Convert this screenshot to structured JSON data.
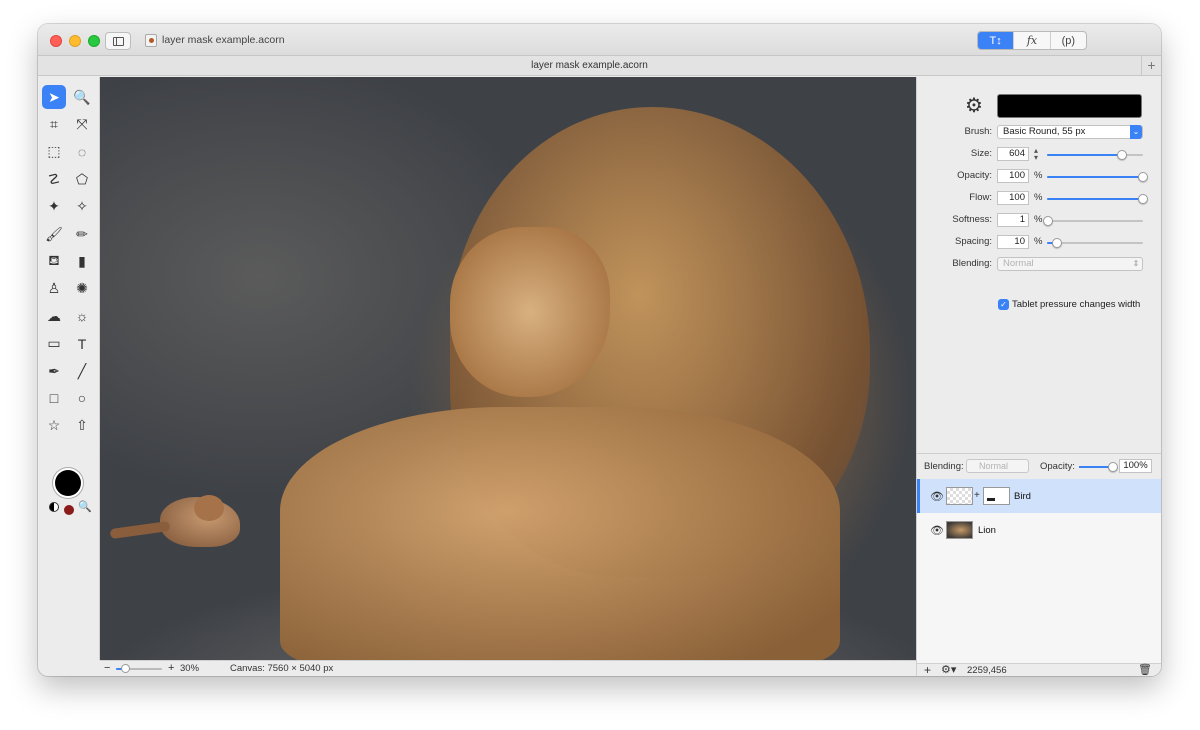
{
  "window": {
    "title": "layer mask example.acorn",
    "tab_title": "layer mask example.acorn",
    "mode_buttons": [
      "T↕",
      "fx",
      "(p)"
    ]
  },
  "tools": [
    {
      "name": "select-arrow-tool-icon",
      "glyph": "➤",
      "active": true
    },
    {
      "name": "zoom-tool-icon",
      "glyph": "🔍"
    },
    {
      "name": "crop-tool-icon",
      "glyph": "⌗"
    },
    {
      "name": "transform-tool-icon",
      "glyph": "⤧"
    },
    {
      "name": "rect-marquee-tool-icon",
      "glyph": "⬚"
    },
    {
      "name": "ellipse-marquee-tool-icon",
      "glyph": "◌"
    },
    {
      "name": "lasso-tool-icon",
      "glyph": "☡"
    },
    {
      "name": "polygon-lasso-tool-icon",
      "glyph": "⬠"
    },
    {
      "name": "magic-wand-tool-icon",
      "glyph": "✦"
    },
    {
      "name": "instant-alpha-tool-icon",
      "glyph": "✧"
    },
    {
      "name": "brush-tool-icon",
      "glyph": "🖌"
    },
    {
      "name": "pencil-tool-icon",
      "glyph": "✏"
    },
    {
      "name": "paint-bucket-tool-icon",
      "glyph": "⛾"
    },
    {
      "name": "eraser-tool-icon",
      "glyph": "▮"
    },
    {
      "name": "clone-tool-icon",
      "glyph": "♙"
    },
    {
      "name": "smudge-tool-icon",
      "glyph": "✺"
    },
    {
      "name": "shape-cloud-tool-icon",
      "glyph": "☁"
    },
    {
      "name": "light-tool-icon",
      "glyph": "☼"
    },
    {
      "name": "gradient-tool-icon",
      "glyph": "▭"
    },
    {
      "name": "text-tool-icon",
      "glyph": "T"
    },
    {
      "name": "bezier-pen-tool-icon",
      "glyph": "✒"
    },
    {
      "name": "line-tool-icon",
      "glyph": "╱"
    },
    {
      "name": "rectangle-tool-icon",
      "glyph": "□"
    },
    {
      "name": "oval-tool-icon",
      "glyph": "○"
    },
    {
      "name": "star-tool-icon",
      "glyph": "☆"
    },
    {
      "name": "arrow-tool-icon",
      "glyph": "⇧"
    }
  ],
  "colors": {
    "foreground": "#000000",
    "background": "#8b1a1a",
    "accent": "#3b82f7"
  },
  "status": {
    "zoom": "30%",
    "zoom_fraction": 0.2,
    "canvas_size": "Canvas: 7560 × 5040 px"
  },
  "brush": {
    "brush_label": "Brush:",
    "brush_value": "Basic Round, 55 px",
    "size_label": "Size:",
    "size_value": "604",
    "size_fraction": 0.78,
    "opacity_label": "Opacity:",
    "opacity_value": "100",
    "opacity_fraction": 1.0,
    "flow_label": "Flow:",
    "flow_value": "100",
    "flow_fraction": 1.0,
    "softness_label": "Softness:",
    "softness_value": "1",
    "softness_fraction": 0.01,
    "spacing_label": "Spacing:",
    "spacing_value": "10",
    "spacing_fraction": 0.1,
    "percent": "%",
    "blending_label": "Blending:",
    "blending_value": "Normal",
    "tablet_label": "Tablet pressure changes width",
    "tablet_checked": true
  },
  "layers_panel": {
    "blending_label": "Blending:",
    "blending_value": "Normal",
    "opacity_label": "Opacity:",
    "opacity_value": "100%",
    "layers": [
      {
        "name": "Bird",
        "selected": true,
        "has_mask": true
      },
      {
        "name": "Lion",
        "selected": false,
        "has_mask": false
      }
    ],
    "coords": "2259,456"
  }
}
